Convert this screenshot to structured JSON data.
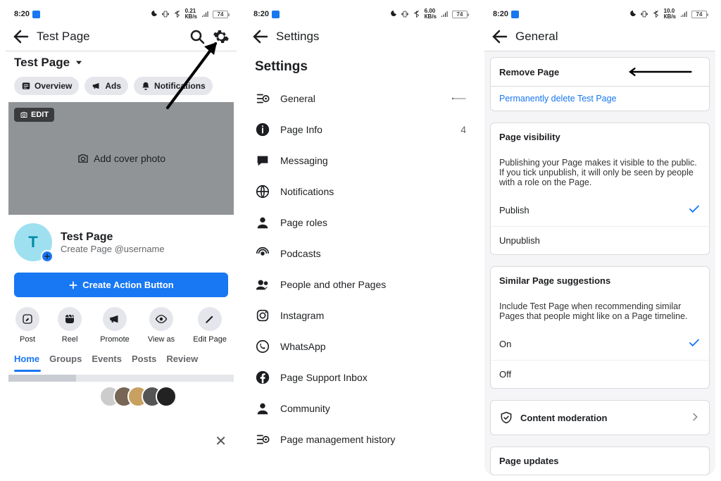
{
  "status": {
    "time": "8:20",
    "battery": "74",
    "net_speed": "0.21",
    "net_speed2": "6.00",
    "net_speed3": "10.0",
    "net_unit": "КВ/s"
  },
  "screen1": {
    "header_title": "Test Page",
    "page_title": "Test Page",
    "chips": {
      "overview": "Overview",
      "ads": "Ads",
      "notifications": "Notifications"
    },
    "edit_badge": "EDIT",
    "add_cover": "Add cover photo",
    "profile_name": "Test Page",
    "profile_sub": "Create Page @username",
    "action_button": "Create Action Button",
    "avatar_letter": "T",
    "actions": {
      "post": "Post",
      "reel": "Reel",
      "promote": "Promote",
      "viewas": "View as",
      "editpage": "Edit Page"
    },
    "tabs": {
      "home": "Home",
      "groups": "Groups",
      "events": "Events",
      "posts": "Posts",
      "review": "Review"
    }
  },
  "screen2": {
    "header_title": "Settings",
    "heading": "Settings",
    "items": {
      "general": "General",
      "page_info": "Page Info",
      "page_info_badge": "4",
      "messaging": "Messaging",
      "notifications": "Notifications",
      "page_roles": "Page roles",
      "podcasts": "Podcasts",
      "people": "People and other Pages",
      "instagram": "Instagram",
      "whatsapp": "WhatsApp",
      "support": "Page Support Inbox",
      "community": "Community",
      "history": "Page management history"
    }
  },
  "screen3": {
    "header_title": "General",
    "remove_page": {
      "title": "Remove Page",
      "link": "Permanently delete Test Page"
    },
    "visibility": {
      "title": "Page visibility",
      "desc": "Publishing your Page makes it visible to the public. If you tick unpublish, it will only be seen by people with a role on the Page.",
      "publish": "Publish",
      "unpublish": "Unpublish"
    },
    "similar": {
      "title": "Similar Page suggestions",
      "desc": "Include Test Page when recommending similar Pages that people might like on a Page timeline.",
      "on": "On",
      "off": "Off"
    },
    "moderation": "Content moderation",
    "updates": "Page updates"
  }
}
